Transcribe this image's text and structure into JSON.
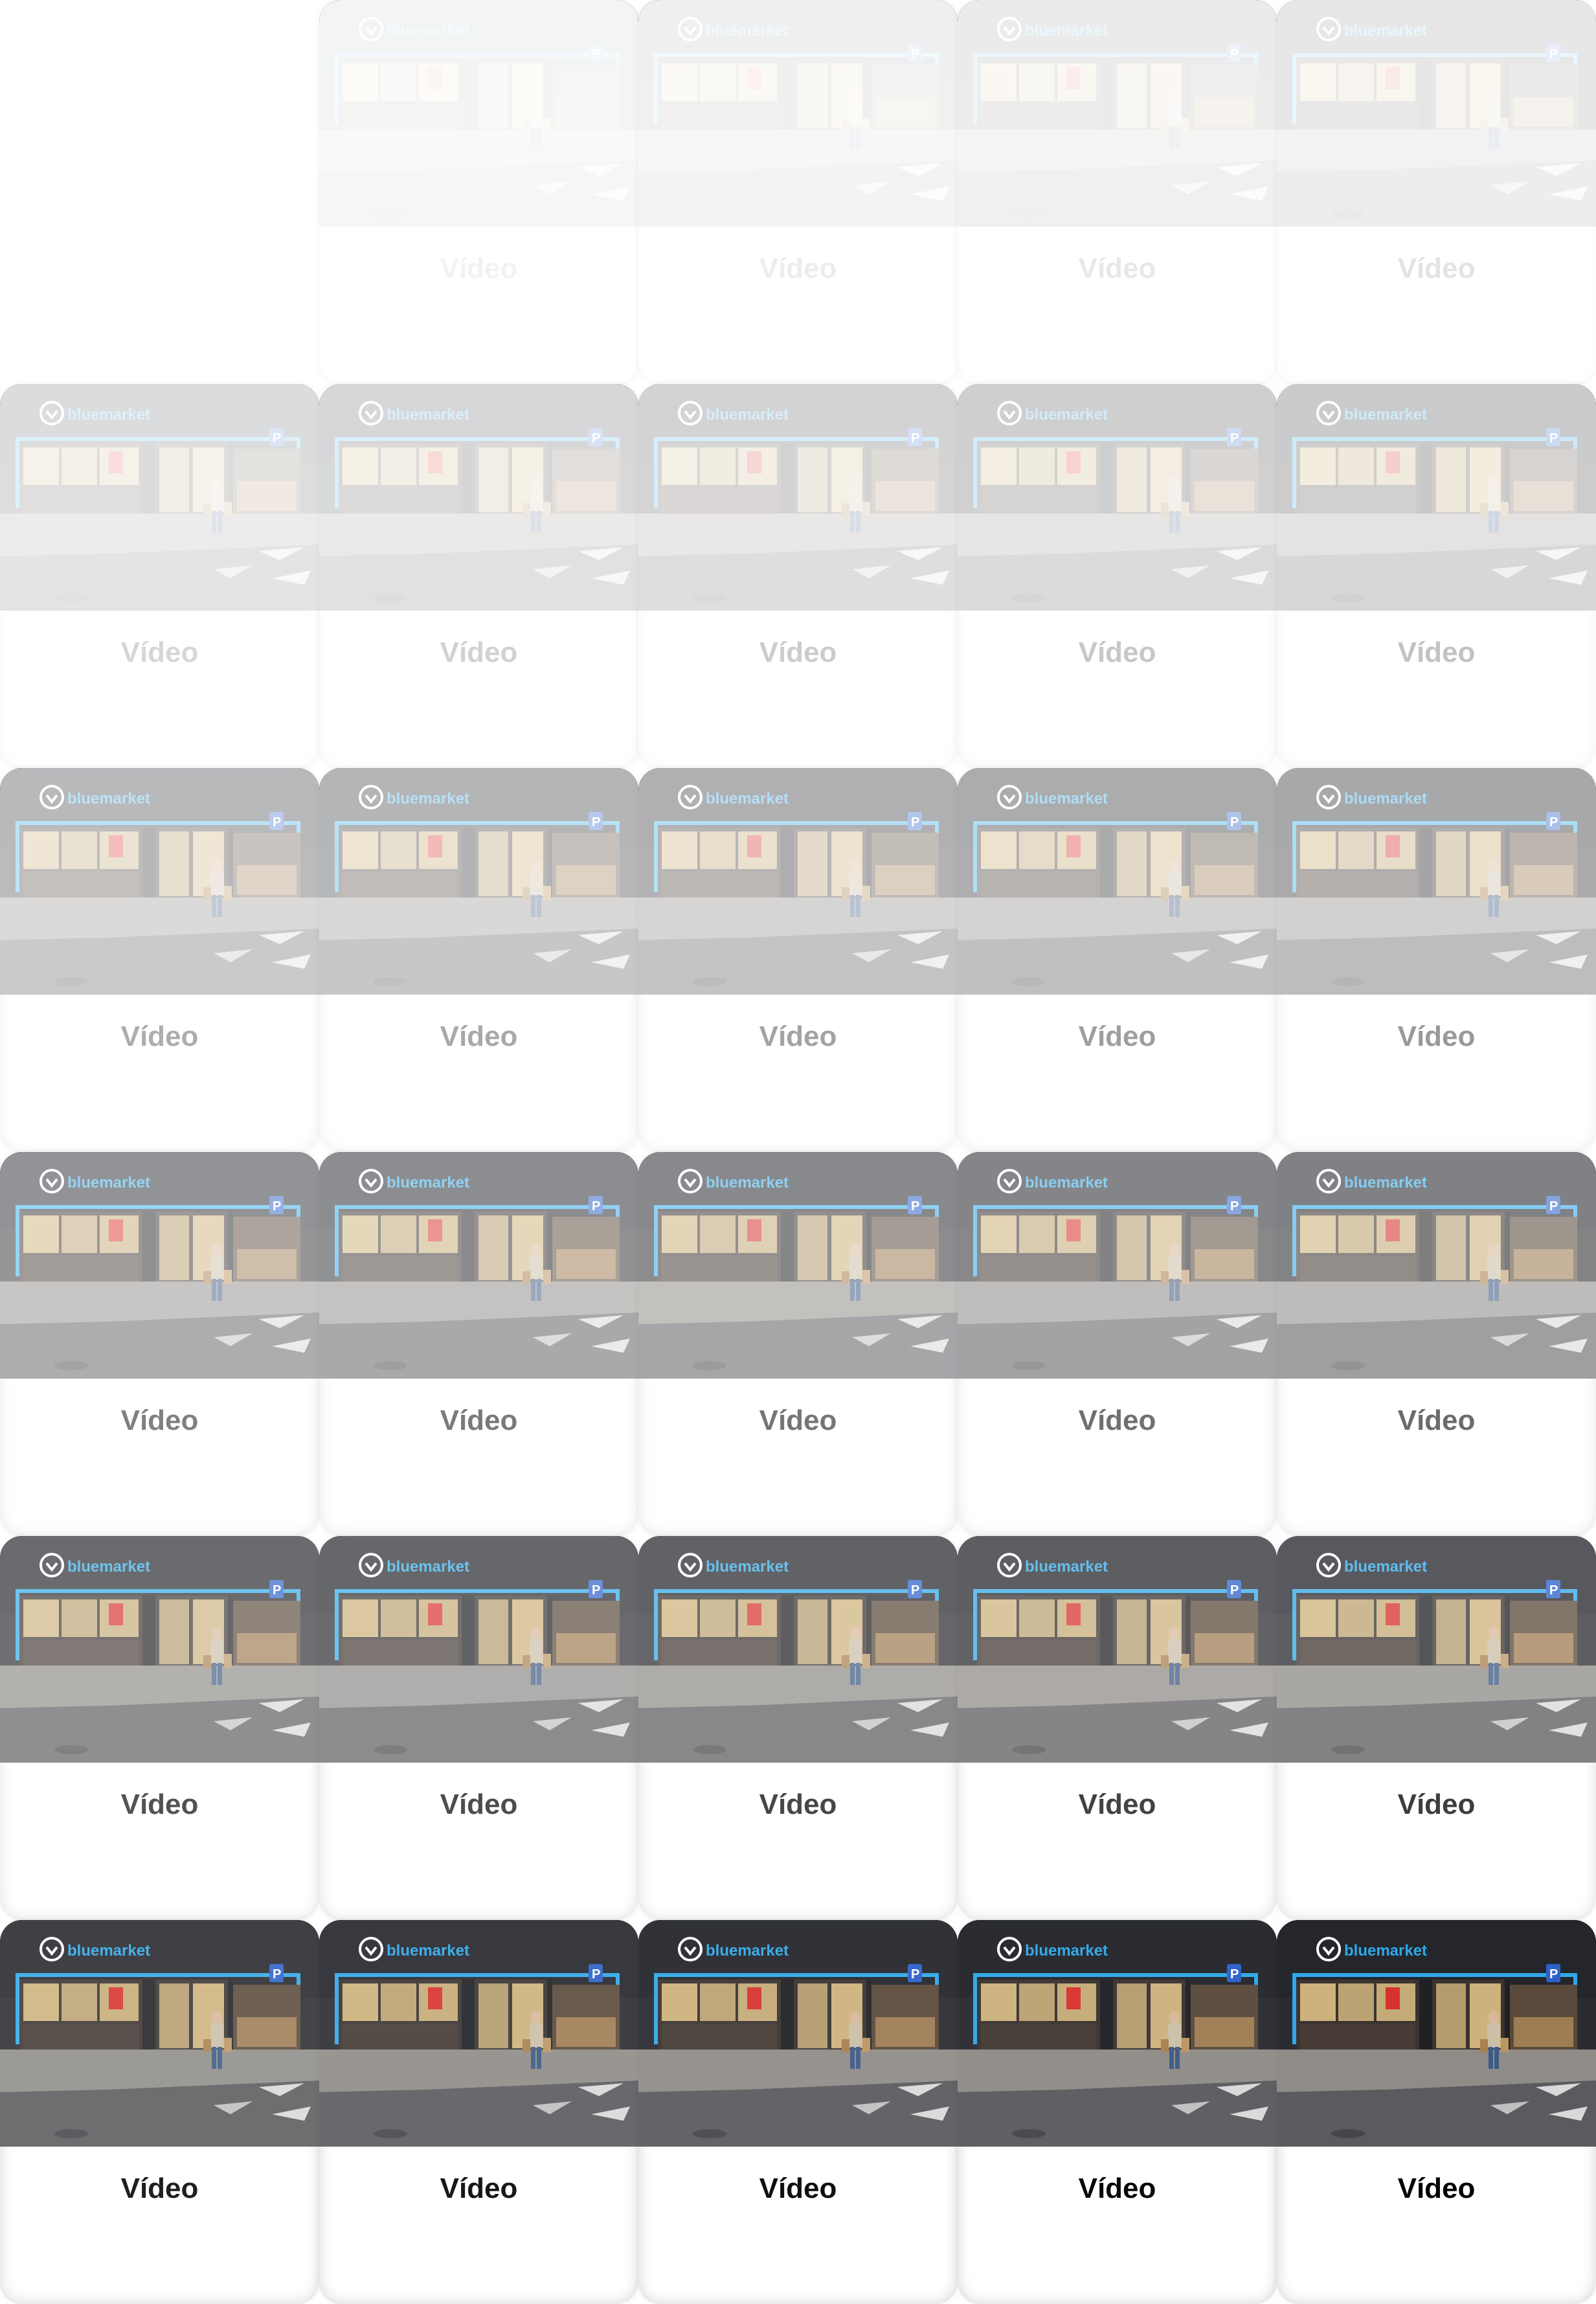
{
  "grid": {
    "columns": 5,
    "rows": 6,
    "empty_cells": [
      0
    ],
    "cells": [
      {
        "label": "",
        "opacity": 0
      },
      {
        "label": "Vídeo",
        "opacity": 0.05
      },
      {
        "label": "Vídeo",
        "opacity": 0.07
      },
      {
        "label": "Vídeo",
        "opacity": 0.09
      },
      {
        "label": "Vídeo",
        "opacity": 0.11
      },
      {
        "label": "Vídeo",
        "opacity": 0.16
      },
      {
        "label": "Vídeo",
        "opacity": 0.18
      },
      {
        "label": "Vídeo",
        "opacity": 0.2
      },
      {
        "label": "Vídeo",
        "opacity": 0.22
      },
      {
        "label": "Vídeo",
        "opacity": 0.24
      },
      {
        "label": "Vídeo",
        "opacity": 0.32
      },
      {
        "label": "Vídeo",
        "opacity": 0.34
      },
      {
        "label": "Vídeo",
        "opacity": 0.36
      },
      {
        "label": "Vídeo",
        "opacity": 0.38
      },
      {
        "label": "Vídeo",
        "opacity": 0.4
      },
      {
        "label": "Vídeo",
        "opacity": 0.5
      },
      {
        "label": "Vídeo",
        "opacity": 0.52
      },
      {
        "label": "Vídeo",
        "opacity": 0.54
      },
      {
        "label": "Vídeo",
        "opacity": 0.56
      },
      {
        "label": "Vídeo",
        "opacity": 0.58
      },
      {
        "label": "Vídeo",
        "opacity": 0.68
      },
      {
        "label": "Vídeo",
        "opacity": 0.7
      },
      {
        "label": "Vídeo",
        "opacity": 0.72
      },
      {
        "label": "Vídeo",
        "opacity": 0.74
      },
      {
        "label": "Vídeo",
        "opacity": 0.76
      },
      {
        "label": "Vídeo",
        "opacity": 0.88
      },
      {
        "label": "Vídeo",
        "opacity": 0.91
      },
      {
        "label": "Vídeo",
        "opacity": 0.94
      },
      {
        "label": "Vídeo",
        "opacity": 0.97
      },
      {
        "label": "Vídeo",
        "opacity": 1.0
      }
    ]
  },
  "thumbnail": {
    "logo_text": "bluemarket",
    "parking_sign": "P",
    "colors": {
      "sky": "#2b2c31",
      "facade": "#24262c",
      "neon": "#2fa8e8",
      "window_warm": "#e8c98a",
      "window_dark": "#3a3330",
      "sidewalk": "#8f8c88",
      "road": "#5b5a5e",
      "road_marking": "#d9d9d9",
      "accent_red": "#d8322f",
      "person_coat": "#cbbfa8",
      "person_jeans": "#3c5a86"
    }
  }
}
